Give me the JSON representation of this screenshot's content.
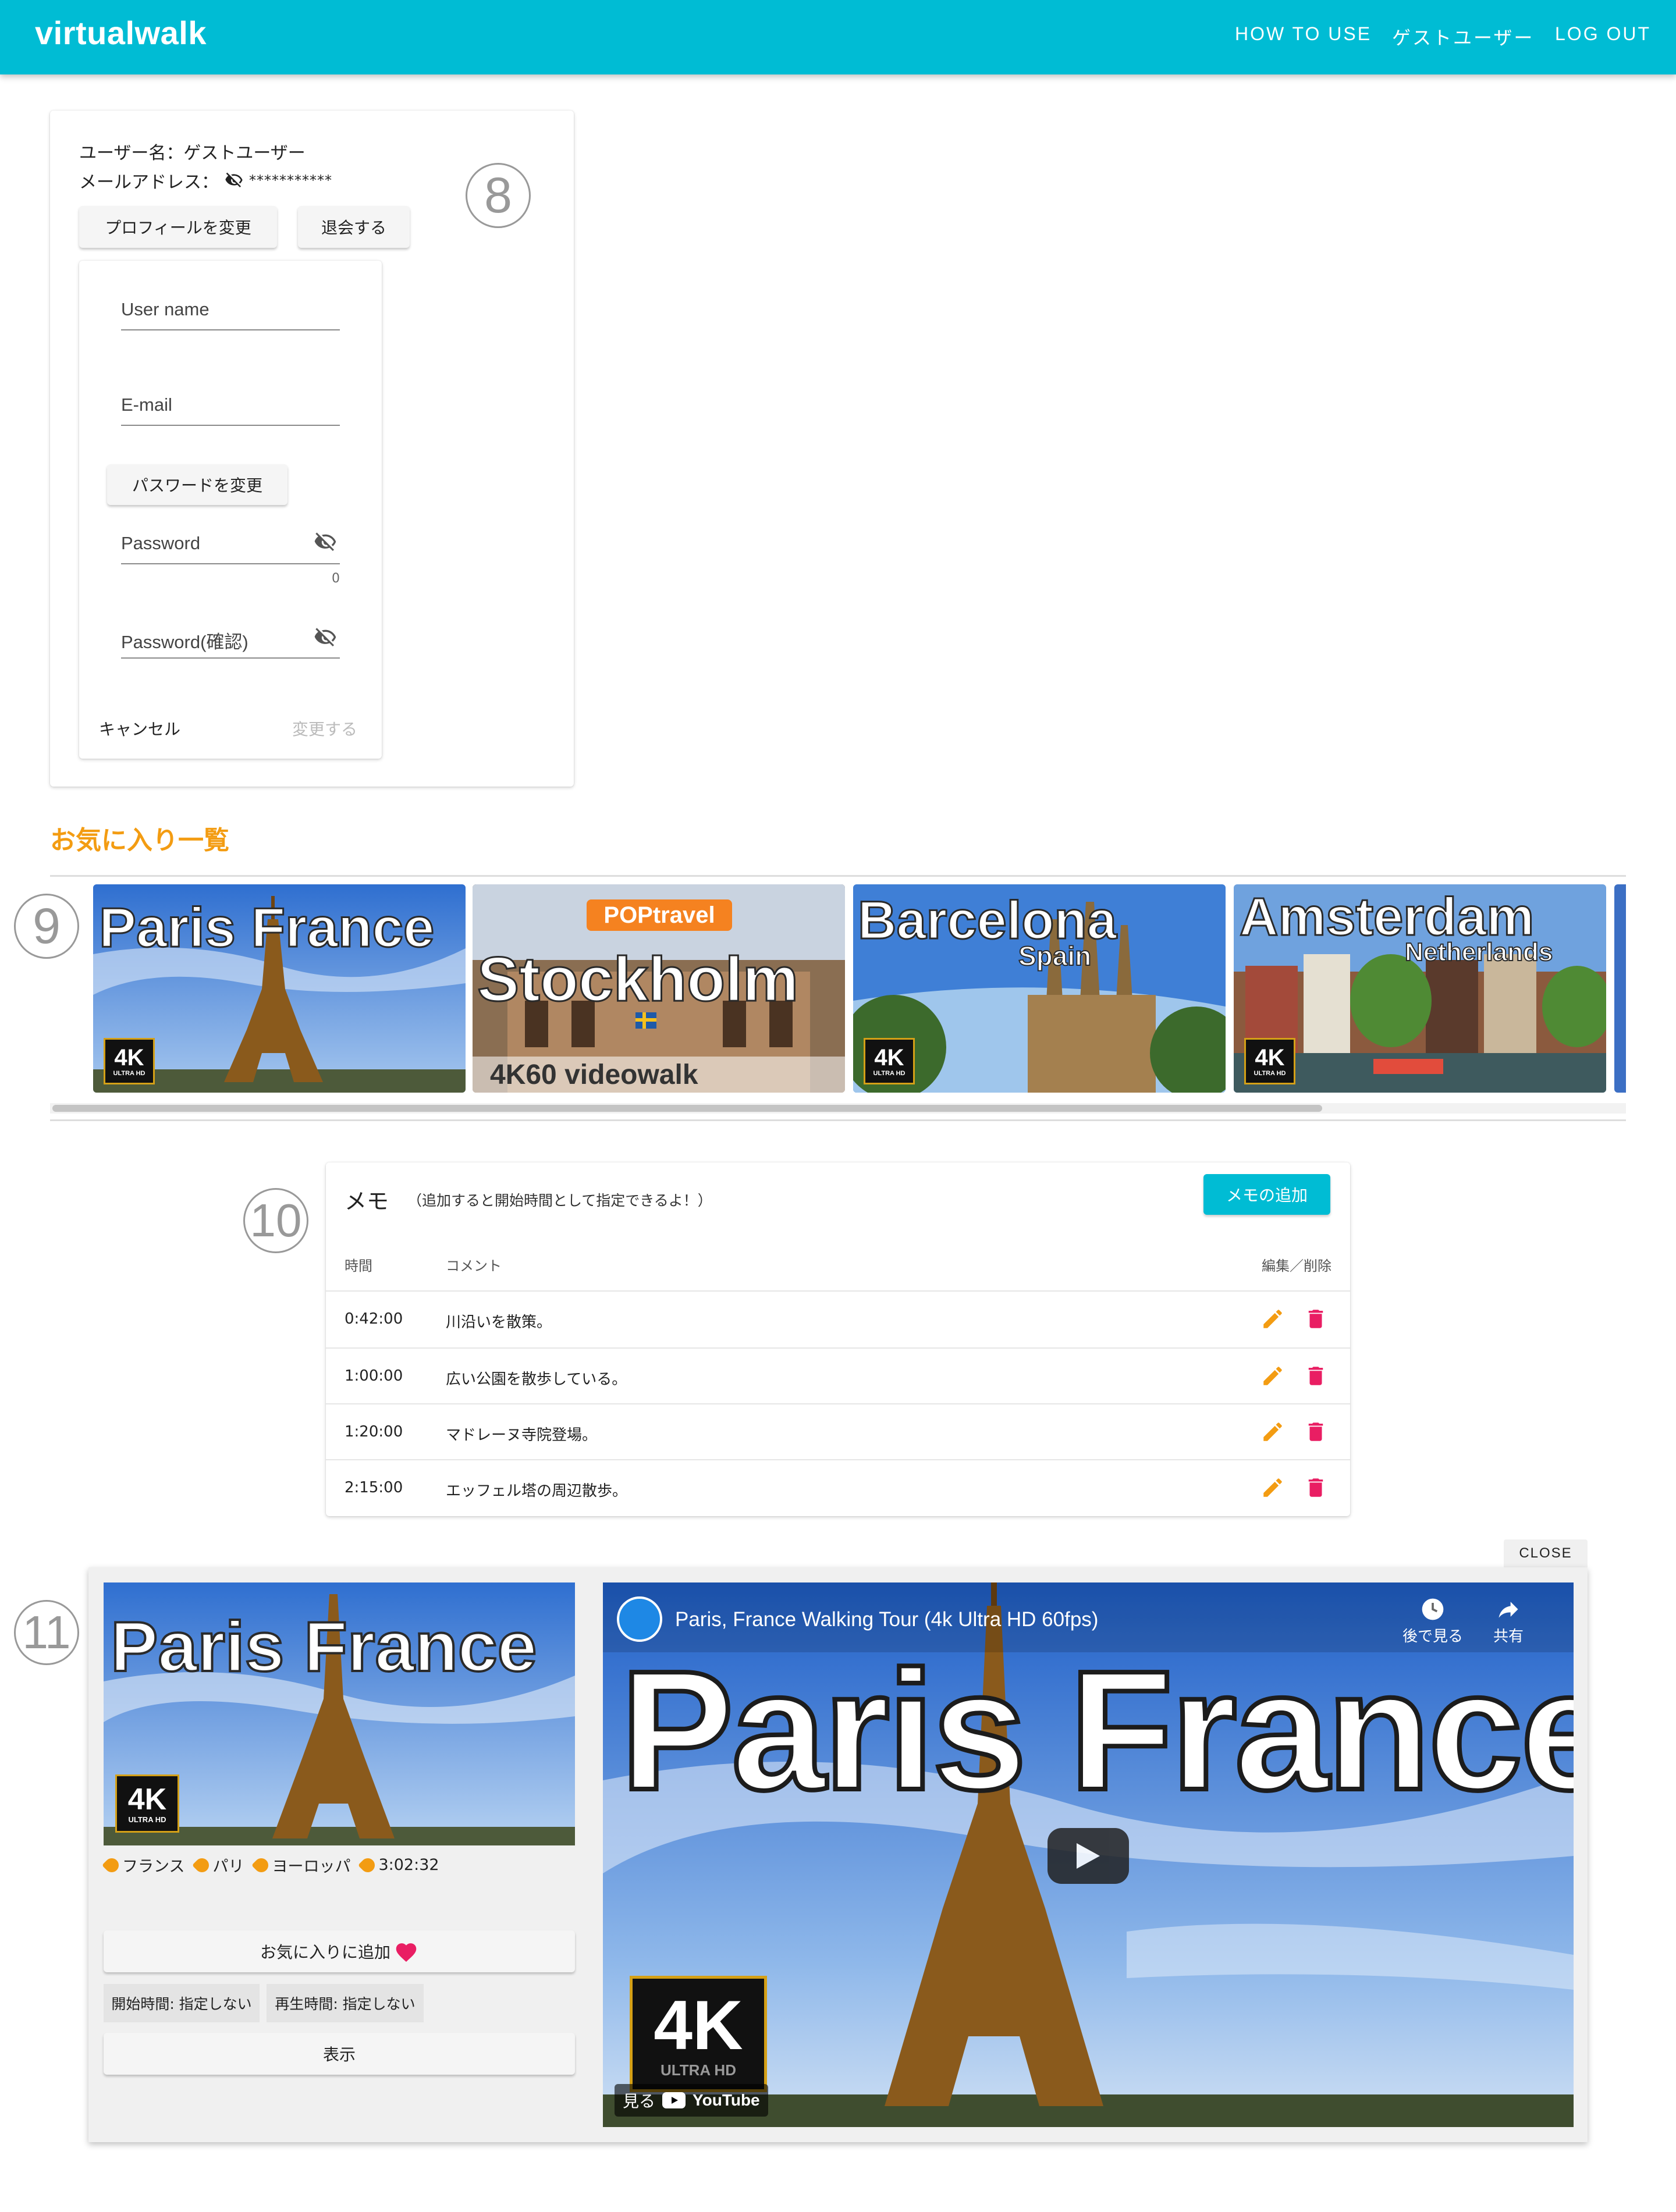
{
  "header": {
    "brand": "virtualwalk",
    "nav": [
      "HOW TO USE",
      "ゲストユーザー",
      "LOG OUT"
    ]
  },
  "profile": {
    "username_line": "ユーザー名：ゲストユーザー",
    "email_label": "メールアドレス：",
    "email_value": "***********",
    "edit_profile_button": "プロフィールを変更",
    "withdraw_button": "退会する",
    "form": {
      "username_label": "User name",
      "email_label": "E-mail",
      "change_password_button": "パスワードを変更",
      "password_label": "Password",
      "password_counter": "0",
      "password_confirm_label": "Password(確認)",
      "cancel_button": "キャンセル",
      "submit_button": "変更する"
    }
  },
  "annotations": [
    "8",
    "9",
    "10",
    "11"
  ],
  "favorites": {
    "title": "お気に入り一覧",
    "items": [
      {
        "title": "Paris France",
        "badge": "4K",
        "badge_sub": "ULTRA HD"
      },
      {
        "title": "Stockholm",
        "brand": "POPtravel",
        "footer": "4K60 videowalk"
      },
      {
        "title": "Barcelona",
        "subtitle": "Spain",
        "badge": "4K",
        "badge_sub": "ULTRA HD"
      },
      {
        "title": "Amsterdam",
        "subtitle": "Netherlands",
        "badge": "4K",
        "badge_sub": "ULTRA HD"
      }
    ]
  },
  "memo": {
    "title": "メモ",
    "hint": "（追加すると開始時間として指定できるよ！）",
    "add_button": "メモの追加",
    "columns": {
      "time": "時間",
      "comment": "コメント",
      "actions": "編集／削除"
    },
    "rows": [
      {
        "time": "0:42:00",
        "comment": "川沿いを散策。"
      },
      {
        "time": "1:00:00",
        "comment": "広い公園を散歩している。"
      },
      {
        "time": "1:20:00",
        "comment": "マドレーヌ寺院登場。"
      },
      {
        "time": "2:15:00",
        "comment": "エッフェル塔の周辺散歩。"
      }
    ]
  },
  "dialog": {
    "close_button": "CLOSE",
    "thumb_title": "Paris France",
    "thumb_badge": "4K",
    "thumb_badge_sub": "ULTRA HD",
    "tags": [
      "フランス",
      "パリ",
      "ヨーロッパ",
      "3:02:32"
    ],
    "favorite_button": "お気に入りに追加",
    "start_time": "開始時間: 指定しない",
    "play_time": "再生時間: 指定しない",
    "show_button": "表示",
    "video": {
      "title": "Paris, France Walking Tour (4k Ultra HD 60fps)",
      "watch_later": "後で見る",
      "share": "共有",
      "big_title": "Paris France",
      "badge": "4K",
      "badge_sub": "ULTRA HD",
      "watch_on": "見る",
      "youtube": "YouTube"
    }
  },
  "colors": {
    "primary": "#00bcd4",
    "accent_orange": "#f39c12",
    "delete_pink": "#e91e63",
    "heart": "#e91e63"
  }
}
